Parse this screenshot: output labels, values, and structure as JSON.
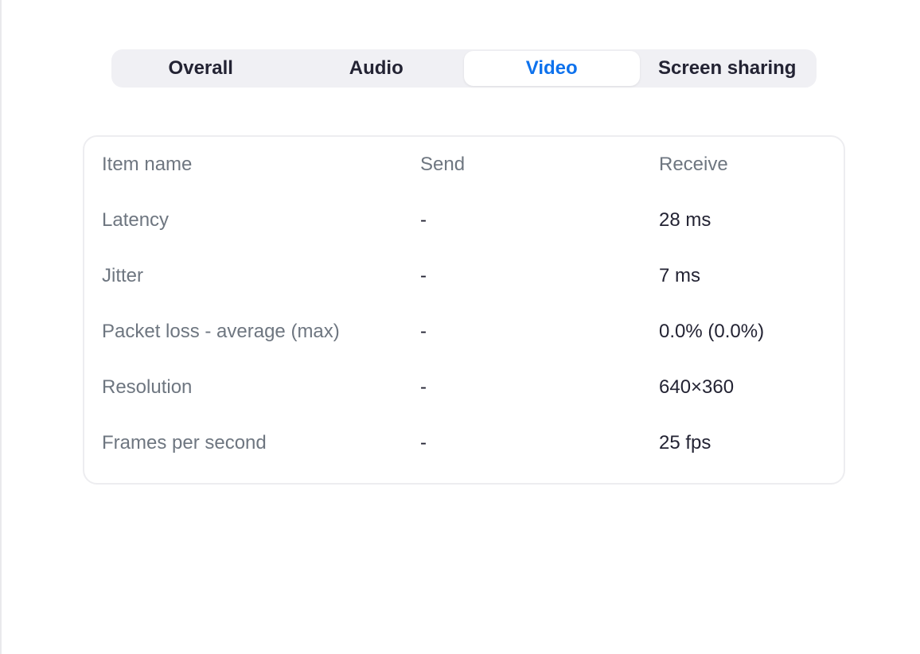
{
  "tabs": [
    {
      "label": "Overall",
      "active": false
    },
    {
      "label": "Audio",
      "active": false
    },
    {
      "label": "Video",
      "active": true
    },
    {
      "label": "Screen sharing",
      "active": false
    }
  ],
  "table": {
    "headers": {
      "name": "Item name",
      "send": "Send",
      "receive": "Receive"
    },
    "rows": [
      {
        "name": "Latency",
        "send": "-",
        "receive": "28 ms"
      },
      {
        "name": "Jitter",
        "send": "-",
        "receive": "7 ms"
      },
      {
        "name": "Packet loss - average (max)",
        "send": "-",
        "receive": "0.0% (0.0%)"
      },
      {
        "name": "Resolution",
        "send": "-",
        "receive": "640×360"
      },
      {
        "name": "Frames per second",
        "send": "-",
        "receive": "25 fps"
      }
    ]
  },
  "colors": {
    "accent": "#0e72ed",
    "tab_bar_bg": "#f0f0f4",
    "label_text": "#6e7680",
    "value_text": "#232333"
  }
}
